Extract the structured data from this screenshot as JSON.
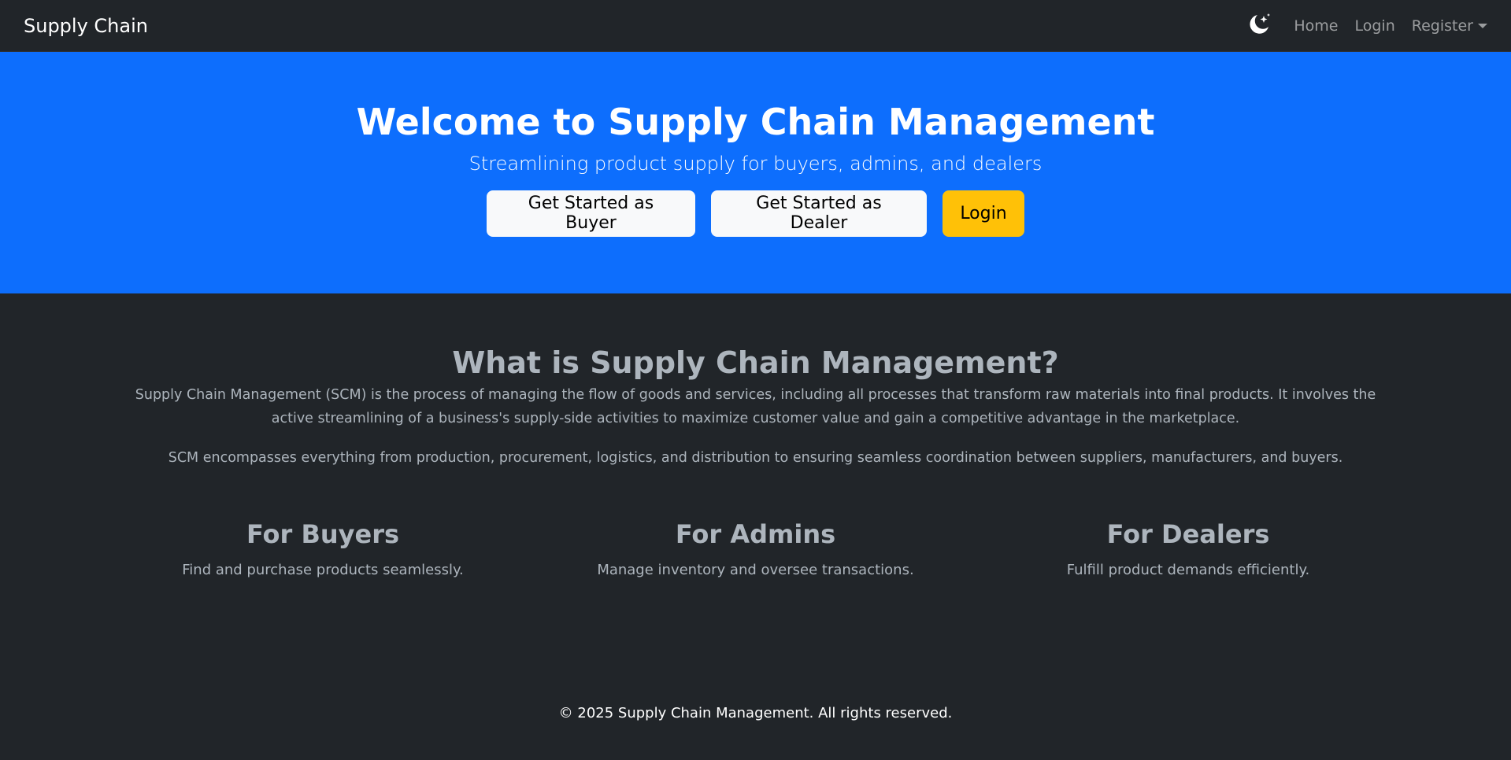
{
  "navbar": {
    "brand": "Supply Chain",
    "theme_toggle_icon": "moon-stars-icon",
    "links": {
      "home": "Home",
      "login": "Login",
      "register": "Register"
    }
  },
  "hero": {
    "title": "Welcome to Supply Chain Management",
    "subtitle": "Streamlining product supply for buyers, admins, and dealers",
    "buttons": {
      "buyer": "Get Started as Buyer",
      "dealer": "Get Started as Dealer",
      "login": "Login"
    }
  },
  "about": {
    "heading": "What is Supply Chain Management?",
    "paragraph1": "Supply Chain Management (SCM) is the process of managing the flow of goods and services, including all processes that transform raw materials into final products. It involves the active streamlining of a business's supply-side activities to maximize customer value and gain a competitive advantage in the marketplace.",
    "paragraph2": "SCM encompasses everything from production, procurement, logistics, and distribution to ensuring seamless coordination between suppliers, manufacturers, and buyers."
  },
  "roles": [
    {
      "title": "For Buyers",
      "text": "Find and purchase products seamlessly."
    },
    {
      "title": "For Admins",
      "text": "Manage inventory and oversee transactions."
    },
    {
      "title": "For Dealers",
      "text": "Fulfill product demands efficiently."
    }
  ],
  "footer": {
    "text": "© 2025 Supply Chain Management. All rights reserved."
  },
  "colors": {
    "background": "#212529",
    "primary": "#0d6efd",
    "warning": "#ffc107",
    "light": "#f8f9fa",
    "muted_text": "#adb5bd"
  }
}
